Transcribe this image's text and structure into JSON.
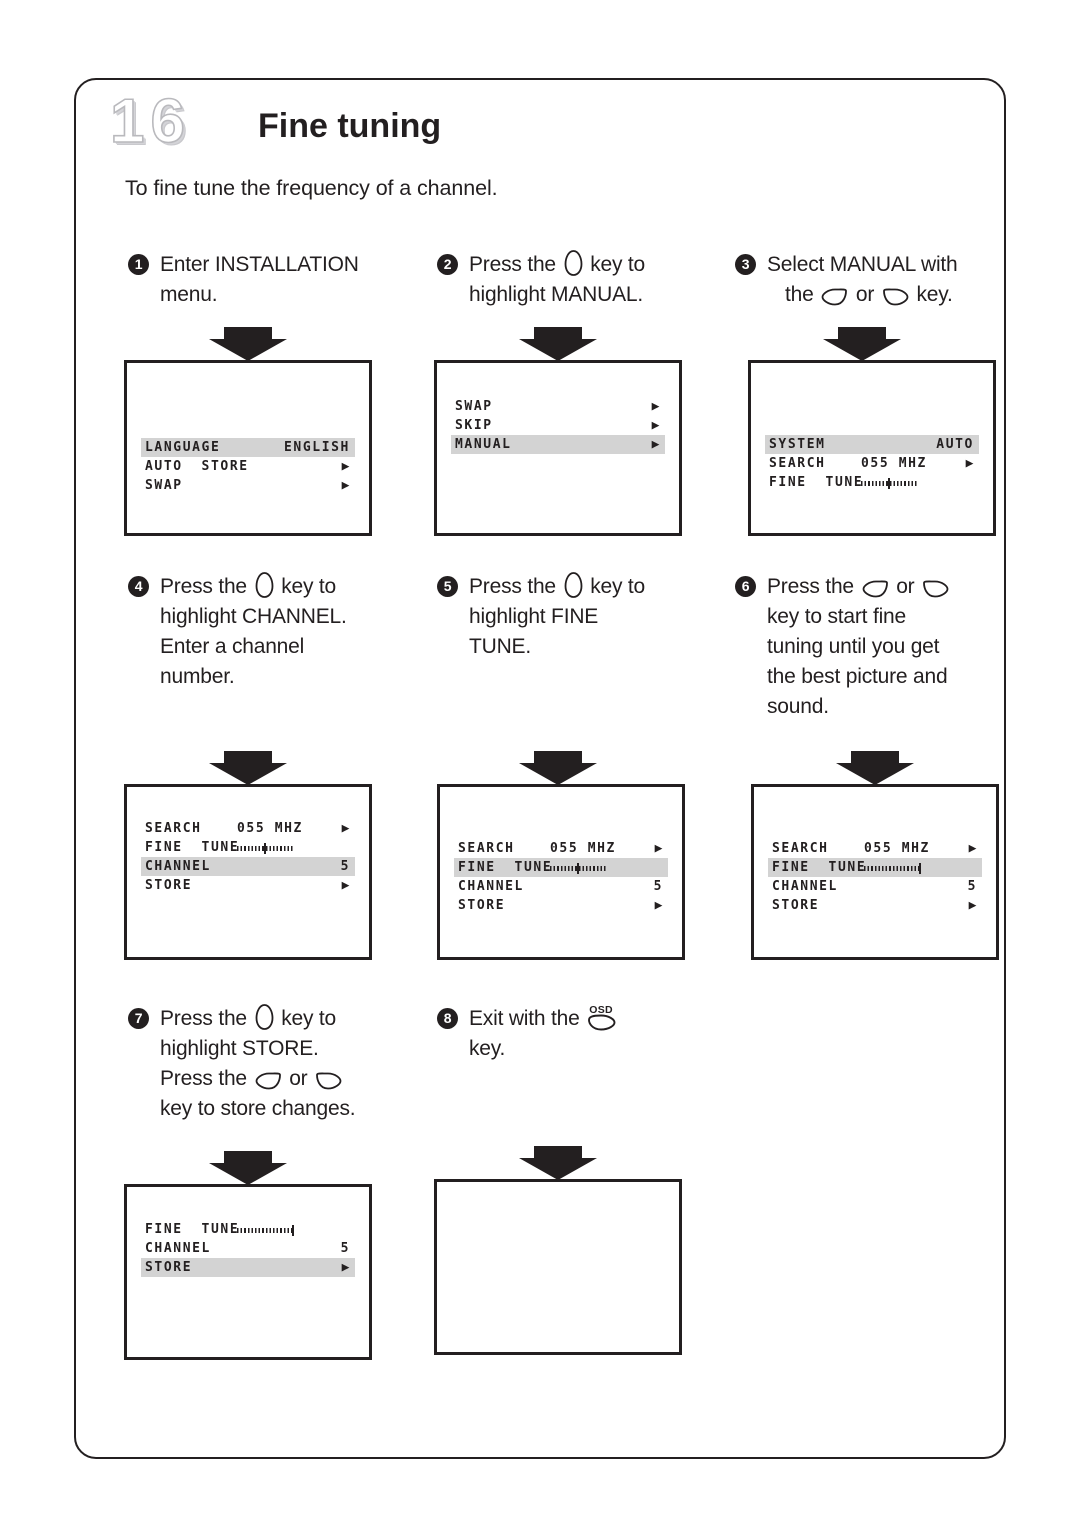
{
  "page": {
    "chapter_number": "16",
    "chapter_title": "Fine tuning",
    "intro": "To fine tune the frequency of a channel."
  },
  "steps": [
    {
      "number": "1",
      "lines": [
        "Enter INSTALLATION",
        "menu."
      ]
    },
    {
      "number": "2",
      "lines_a": "Press the",
      "lines_b": "key to",
      "lines_c": "highlight MANUAL."
    },
    {
      "number": "3",
      "lines_a": "Select MANUAL with",
      "lines_b": "the",
      "lines_c": "or",
      "lines_d": "key."
    },
    {
      "number": "4",
      "lines_a": "Press the",
      "lines_b": "key to",
      "lines_c": "highlight CHANNEL.",
      "lines_d": "Enter a channel",
      "lines_e": "number."
    },
    {
      "number": "5",
      "lines_a": "Press the",
      "lines_b": "key to",
      "lines_c": "highlight FINE",
      "lines_d": "TUNE."
    },
    {
      "number": "6",
      "lines_a": "Press the",
      "lines_b": "or",
      "lines_c": "key to start fine",
      "lines_d": "tuning until you get",
      "lines_e": "the best picture and",
      "lines_f": "sound."
    },
    {
      "number": "7",
      "lines_a": "Press the",
      "lines_b": "key to",
      "lines_c": "highlight STORE.",
      "lines_d": "Press the",
      "lines_e": "or",
      "lines_f": "key to store changes."
    },
    {
      "number": "8",
      "lines_a": "Exit with the",
      "lines_b": "key.",
      "key_label": "OSD"
    }
  ],
  "osd_screens": [
    {
      "id": "screen-1",
      "rows": [
        {
          "label": "LANGUAGE",
          "value": "ENGLISH",
          "caret": "",
          "highlight": true
        },
        {
          "label": "AUTO  STORE",
          "value": "",
          "caret": "▶",
          "highlight": false
        },
        {
          "label": "SWAP",
          "value": "",
          "caret": "▶",
          "highlight": false
        }
      ]
    },
    {
      "id": "screen-2",
      "rows": [
        {
          "label": "SWAP",
          "value": "",
          "caret": "▶",
          "highlight": false
        },
        {
          "label": "SKIP",
          "value": "",
          "caret": "▶",
          "highlight": false
        },
        {
          "label": "MANUAL",
          "value": "",
          "caret": "▶",
          "highlight": true
        }
      ]
    },
    {
      "id": "screen-3",
      "rows": [
        {
          "label": "SYSTEM",
          "value": "AUTO",
          "caret": "",
          "highlight": true
        },
        {
          "label": "SEARCH",
          "value": "055 MHZ",
          "caret": "▶",
          "highlight": false,
          "value_mid": true
        },
        {
          "label": "FINE  TUNE",
          "value": "",
          "caret": "",
          "highlight": false,
          "slider": 50
        }
      ]
    },
    {
      "id": "screen-4",
      "rows": [
        {
          "label": "SEARCH",
          "value": "055 MHZ",
          "caret": "▶",
          "highlight": false,
          "value_mid": true
        },
        {
          "label": "FINE  TUNE",
          "value": "",
          "caret": "",
          "highlight": false,
          "slider": 50
        },
        {
          "label": "CHANNEL",
          "value": "5",
          "caret": "",
          "highlight": true
        },
        {
          "label": "STORE",
          "value": "",
          "caret": "▶",
          "highlight": false
        }
      ]
    },
    {
      "id": "screen-5",
      "rows": [
        {
          "label": "SEARCH",
          "value": "055 MHZ",
          "caret": "▶",
          "highlight": false,
          "value_mid": true
        },
        {
          "label": "FINE  TUNE",
          "value": "",
          "caret": "",
          "highlight": true,
          "slider": 50
        },
        {
          "label": "CHANNEL",
          "value": "5",
          "caret": "",
          "highlight": false
        },
        {
          "label": "STORE",
          "value": "",
          "caret": "▶",
          "highlight": false
        }
      ]
    },
    {
      "id": "screen-6",
      "rows": [
        {
          "label": "SEARCH",
          "value": "055 MHZ",
          "caret": "▶",
          "highlight": false,
          "value_mid": true
        },
        {
          "label": "FINE  TUNE",
          "value": "",
          "caret": "",
          "highlight": true,
          "slider": 100
        },
        {
          "label": "CHANNEL",
          "value": "5",
          "caret": "",
          "highlight": false
        },
        {
          "label": "STORE",
          "value": "",
          "caret": "▶",
          "highlight": false
        }
      ]
    },
    {
      "id": "screen-7",
      "rows": [
        {
          "label": "FINE  TUNE",
          "value": "",
          "caret": "",
          "highlight": false,
          "slider": 100
        },
        {
          "label": "CHANNEL",
          "value": "5",
          "caret": "",
          "highlight": false
        },
        {
          "label": "STORE",
          "value": "",
          "caret": "▶",
          "highlight": true
        }
      ]
    },
    {
      "id": "screen-8",
      "rows": []
    }
  ],
  "colors": {
    "ink": "#231f20",
    "highlight": "#d3d3d3",
    "chapter_outline": "#b9b9bd"
  }
}
